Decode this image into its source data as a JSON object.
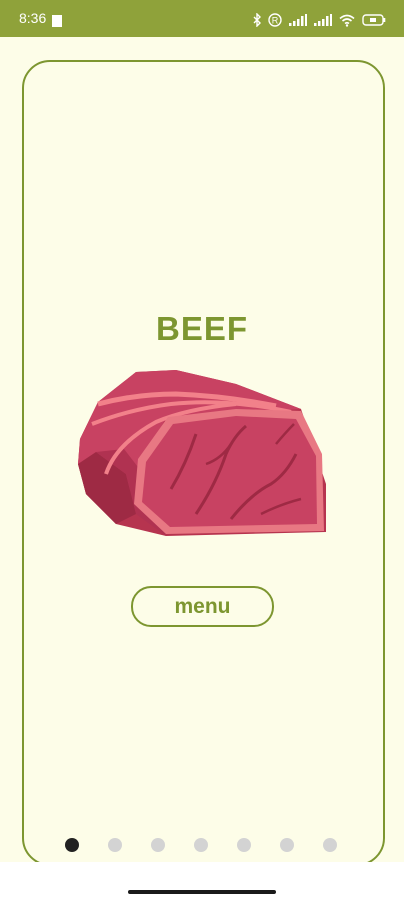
{
  "status_bar": {
    "time": "8:36",
    "icons": [
      "bluetooth-icon",
      "registered-icon",
      "signal-icon",
      "signal-icon",
      "wifi-icon",
      "battery-icon"
    ],
    "color": "#8fa23a"
  },
  "screen": {
    "title": "BEEF",
    "image": "beef-steak-illustration",
    "menu_label": "menu",
    "accent_color": "#7d9630",
    "background_color": "#fdfde8"
  },
  "pager": {
    "total_pages": 7,
    "current_page": 1
  }
}
